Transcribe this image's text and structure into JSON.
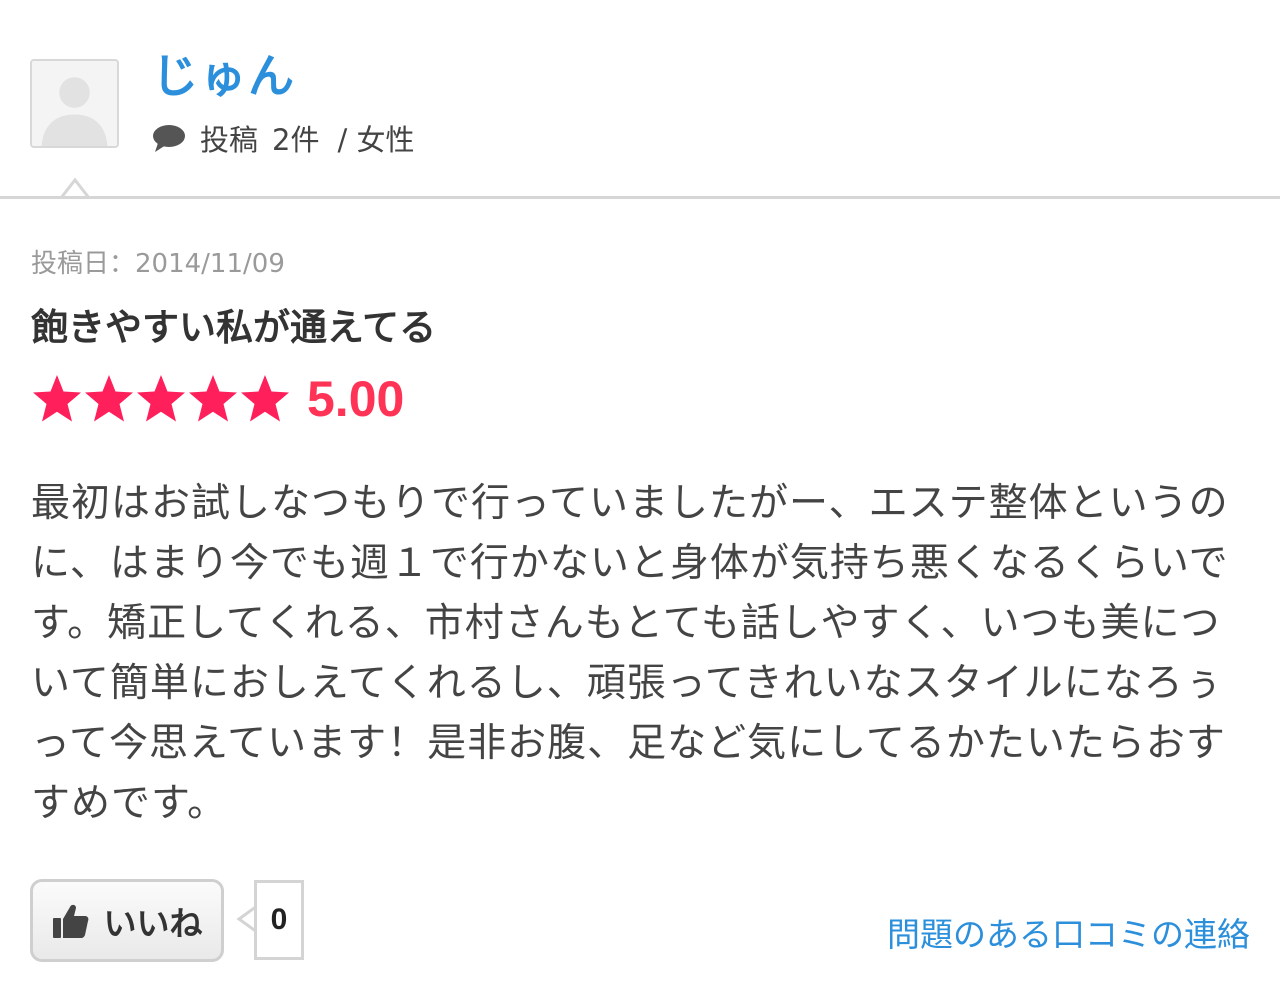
{
  "user": {
    "name": "じゅん",
    "posts_label": "投稿",
    "posts_count": "2件",
    "gender": "/ 女性"
  },
  "review": {
    "date": "投稿日：2014/11/09",
    "title": "飽きやすい私が通えてる",
    "rating": 5,
    "rating_max": 5,
    "score": "5.00",
    "body": "最初はお試しなつもりで行っていましたがー、エステ整体というのに、はまり今でも週１で行かないと身体が気持ち悪くなるくらいです。矯正してくれる、市村さんもとても話しやすく、いつも美について簡単におしえてくれるし、頑張ってきれいなスタイルになろぅって今思えています！是非お腹、足など気にしてるかたいたらおすすめです。"
  },
  "actions": {
    "like_label": "いいね",
    "like_count": "0",
    "report_label": "問題のある口コミの連絡"
  },
  "icons": {
    "avatar": "user-silhouette-icon",
    "comment": "comment-bubble-icon",
    "thumb": "thumbs-up-icon",
    "star": "star-icon"
  },
  "colors": {
    "username": "#2b8fdc",
    "star": "#ff1f5a",
    "score": "#ff3355",
    "link": "#2b8fdc"
  }
}
